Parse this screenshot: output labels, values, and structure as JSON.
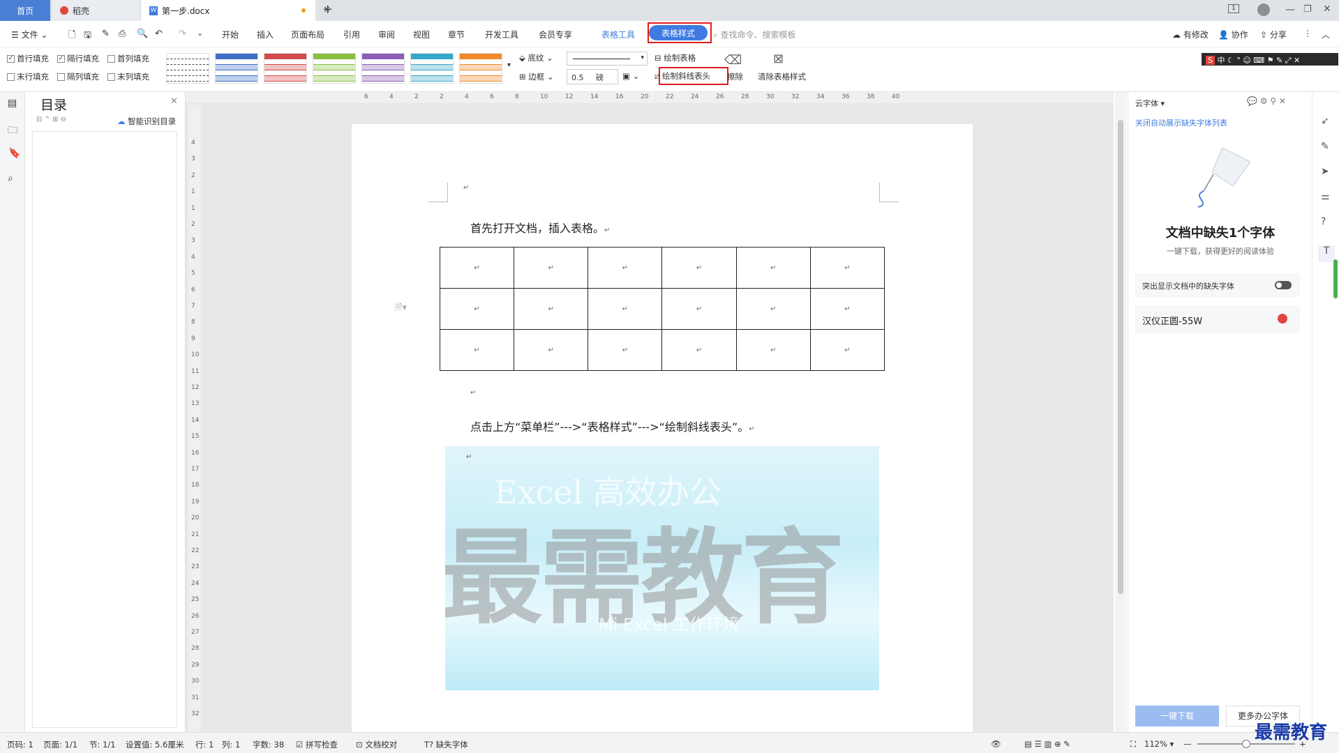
{
  "tabs": {
    "home": "首页",
    "docer": "稻壳",
    "doc": "第一步.docx",
    "new": "+"
  },
  "menu": {
    "file": "文件",
    "items": [
      "开始",
      "插入",
      "页面布局",
      "引用",
      "审阅",
      "视图",
      "章节",
      "开发工具",
      "会员专享"
    ],
    "table_tools": "表格工具",
    "table_style": "表格样式",
    "search": "查找命令、搜索模板",
    "modified": "有修改",
    "collab": "协作",
    "share": "分享"
  },
  "ribbon": {
    "checks": [
      {
        "label": "首行填充",
        "checked": true
      },
      {
        "label": "隔行填充",
        "checked": true
      },
      {
        "label": "首列填充",
        "checked": false
      },
      {
        "label": "末行填充",
        "checked": false
      },
      {
        "label": "隔列填充",
        "checked": false
      },
      {
        "label": "末列填充",
        "checked": false
      }
    ],
    "shading": "底纹",
    "border": "边框",
    "line_width": "0.5",
    "unit": "磅",
    "draw_table": "绘制表格",
    "draw_diagonal": "绘制斜线表头",
    "erase": "擦除",
    "clear_style": "清除表格样式",
    "ime": "中"
  },
  "style_colors": [
    "#444444",
    "#3f6fc4",
    "#d24a4a",
    "#8bbf3f",
    "#8a5fb5",
    "#33a9c9",
    "#ef8a2b"
  ],
  "toc": {
    "title": "目录",
    "smart": "智能识别目录"
  },
  "ruler": {
    "h": [
      "6",
      "4",
      "2",
      "2",
      "4",
      "6",
      "8",
      "10",
      "12",
      "14",
      "16",
      "20",
      "22",
      "24",
      "26",
      "28",
      "30",
      "32",
      "34",
      "36",
      "38",
      "40"
    ],
    "v": [
      "4",
      "3",
      "2",
      "1",
      "1",
      "2",
      "3",
      "4",
      "5",
      "6",
      "7",
      "8",
      "9",
      "10",
      "11",
      "12",
      "13",
      "14",
      "15",
      "16",
      "17",
      "18",
      "19",
      "20",
      "21",
      "22",
      "23",
      "24",
      "25",
      "26",
      "27",
      "28",
      "29",
      "30",
      "31",
      "32"
    ]
  },
  "doc": {
    "mark": "↵",
    "line1": "首先打开文档，插入表格。",
    "line2": "点击上方“菜单栏”--->“表格样式”--->“绘制斜线表头”。",
    "watermark_big": "最需教育",
    "watermark_top": "Excel 高效办公",
    "watermark_bottom": "Mi Excel 工作环境"
  },
  "rpanel": {
    "title": "云字体",
    "link": "关闭自动展示缺失字体列表",
    "heading": "文档中缺失1个字体",
    "sub": "一键下载，获得更好的阅读体验",
    "toggle_label": "突出显示文档中的缺失字体",
    "font": "汉仪正圆-55W",
    "download": "一键下载",
    "more": "更多办公字体"
  },
  "status": {
    "page": "页码: 1",
    "pages": "页面: 1/1",
    "section": "节: 1/1",
    "setting": "设置值: 5.6厘米",
    "row": "行: 1",
    "col": "列: 1",
    "words": "字数: 38",
    "spell": "拼写检查",
    "proof": "文档校对",
    "missing": "缺失字体",
    "zoom": "112%"
  },
  "brand": "最需教育"
}
